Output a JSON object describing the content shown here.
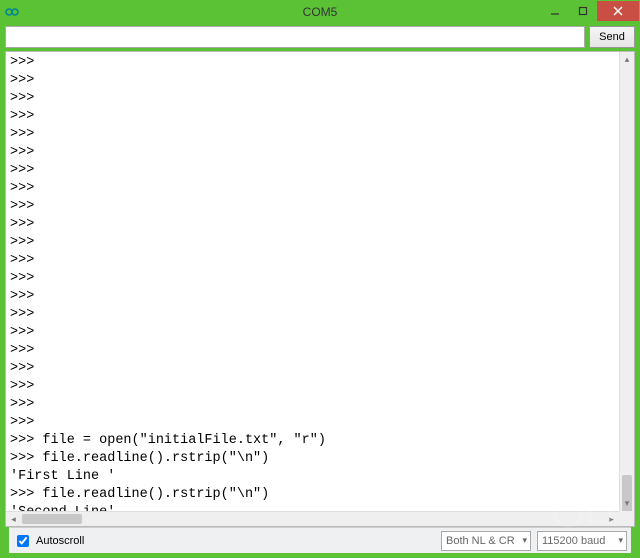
{
  "titlebar": {
    "title": "COM5"
  },
  "toolbar": {
    "send_label": "Send",
    "input_value": ""
  },
  "console_text": ">>> \n>>> \n>>> \n>>> \n>>> \n>>> \n>>> \n>>> \n>>> \n>>> \n>>> \n>>> \n>>> \n>>> \n>>> \n>>> \n>>> \n>>> \n>>> \n>>> \n>>> \n>>> file = open(\"initialFile.txt\", \"r\")\n>>> file.readline().rstrip(\"\\n\")\n'First Line '\n>>> file.readline().rstrip(\"\\n\")\n'Second Line'\n>>> ",
  "footer": {
    "autoscroll_label": "Autoscroll",
    "autoscroll_checked": true,
    "line_ending_label": "Both NL & CR",
    "baud_label": "115200 baud"
  }
}
